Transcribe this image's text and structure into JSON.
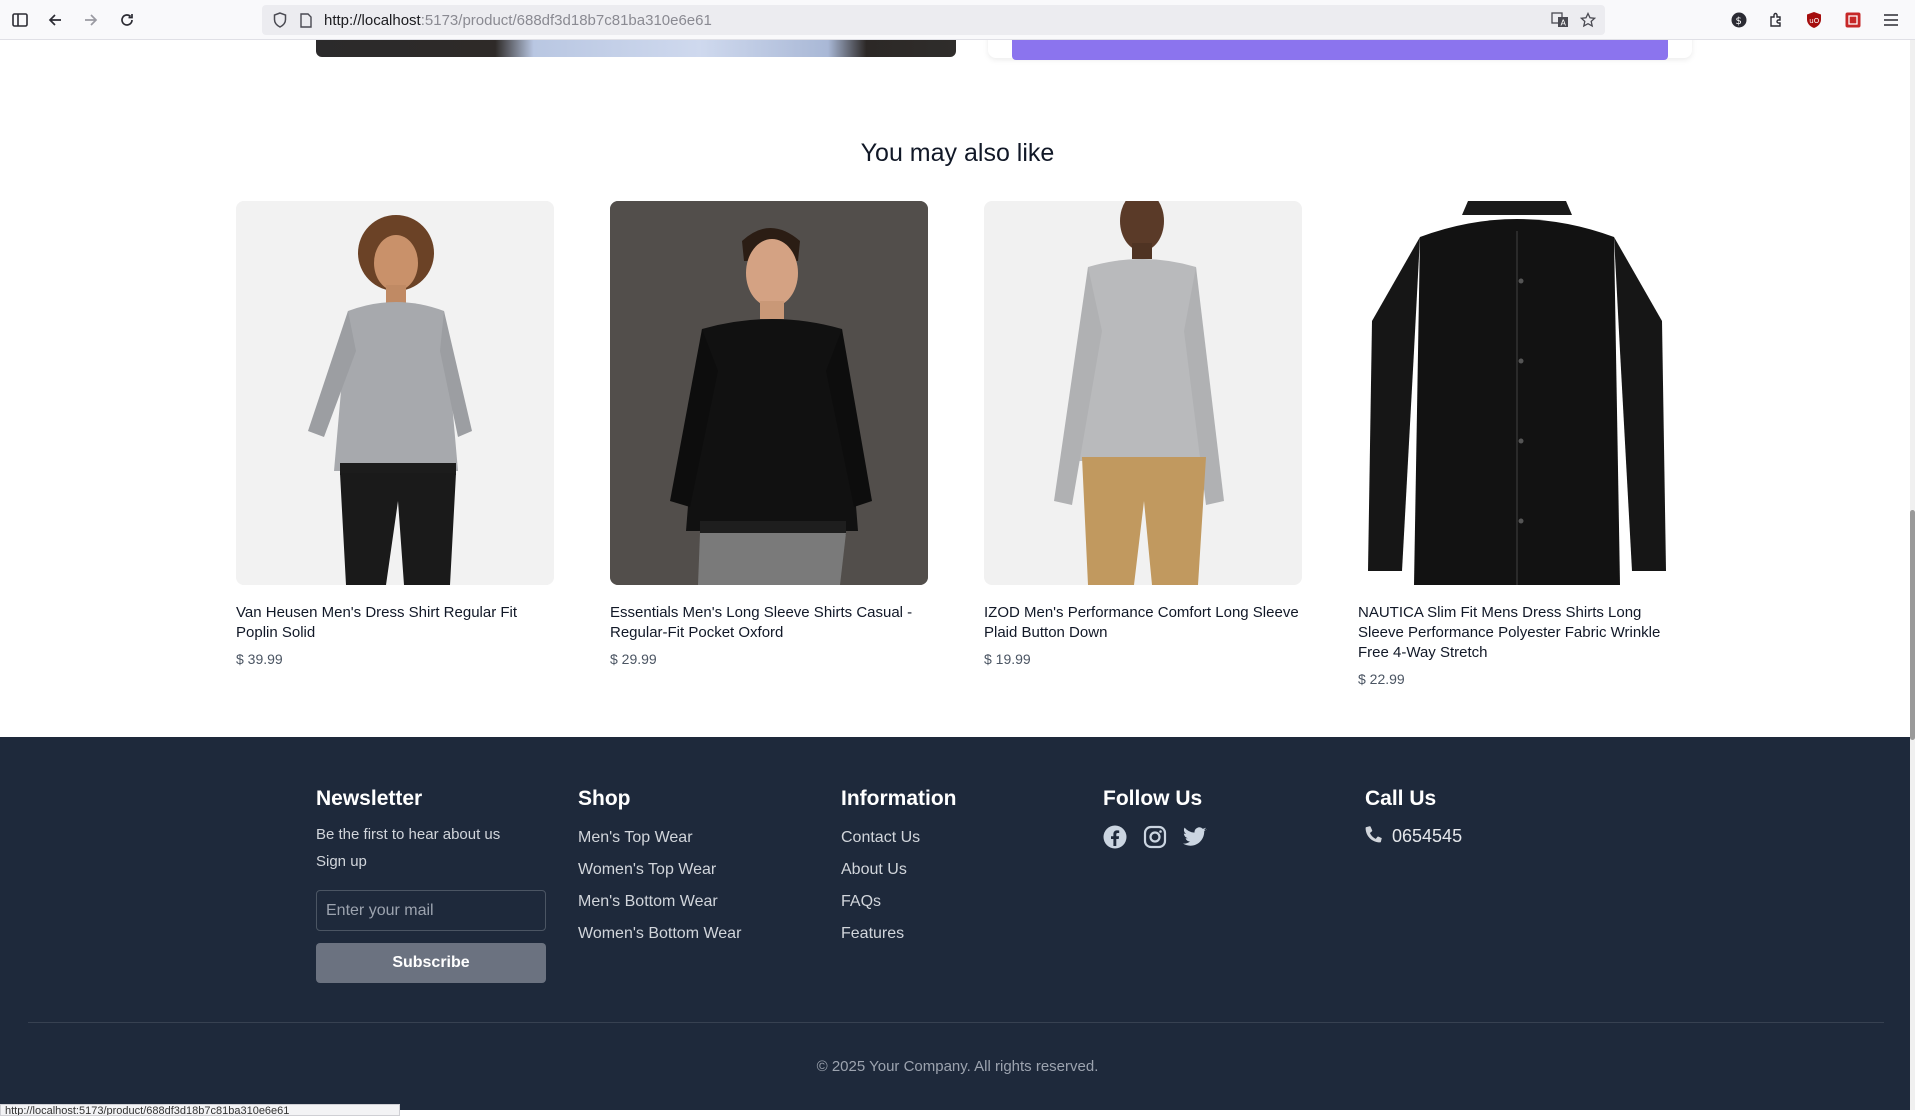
{
  "browser": {
    "url_host": "http://localhost",
    "url_path": ":5173/product/688df3d18b7c81ba310e6e61",
    "status_url": "http://localhost:5173/product/688df3d18b7c81ba310e6e61"
  },
  "related": {
    "title": "You may also like",
    "products": [
      {
        "name": "Van Heusen Men's Dress Shirt Regular Fit Poplin Solid",
        "price": "$ 39.99",
        "image": "grey-dress-shirt-model"
      },
      {
        "name": "Essentials Men's Long Sleeve Shirts Casual - Regular-Fit Pocket Oxford",
        "price": "$ 29.99",
        "image": "black-shirt-model"
      },
      {
        "name": "IZOD Men's Performance Comfort Long Sleeve Plaid Button Down",
        "price": "$ 19.99",
        "image": "grey-plaid-shirt-model"
      },
      {
        "name": "NAUTICA Slim Fit Mens Dress Shirts Long Sleeve Performance Polyester Fabric Wrinkle Free 4-Way Stretch",
        "price": "$ 22.99",
        "image": "black-shirt-flatlay"
      }
    ]
  },
  "footer": {
    "newsletter": {
      "title": "Newsletter",
      "tagline": "Be the first to hear about us",
      "signup": "Sign up",
      "placeholder": "Enter your mail",
      "button": "Subscribe"
    },
    "shop": {
      "title": "Shop",
      "links": [
        "Men's Top Wear",
        "Women's Top Wear",
        "Men's Bottom Wear",
        "Women's Bottom Wear"
      ]
    },
    "information": {
      "title": "Information",
      "links": [
        "Contact Us",
        "About Us",
        "FAQs",
        "Features"
      ]
    },
    "follow": {
      "title": "Follow Us",
      "icons": [
        "facebook-icon",
        "instagram-icon",
        "twitter-icon"
      ]
    },
    "call": {
      "title": "Call Us",
      "phone": "0654545"
    },
    "copyright": "© 2025 Your Company. All rights reserved."
  },
  "colors": {
    "footer_bg": "#1e293b",
    "accent_purple": "#8b74ee",
    "subscribe_bg": "#6b7280"
  }
}
